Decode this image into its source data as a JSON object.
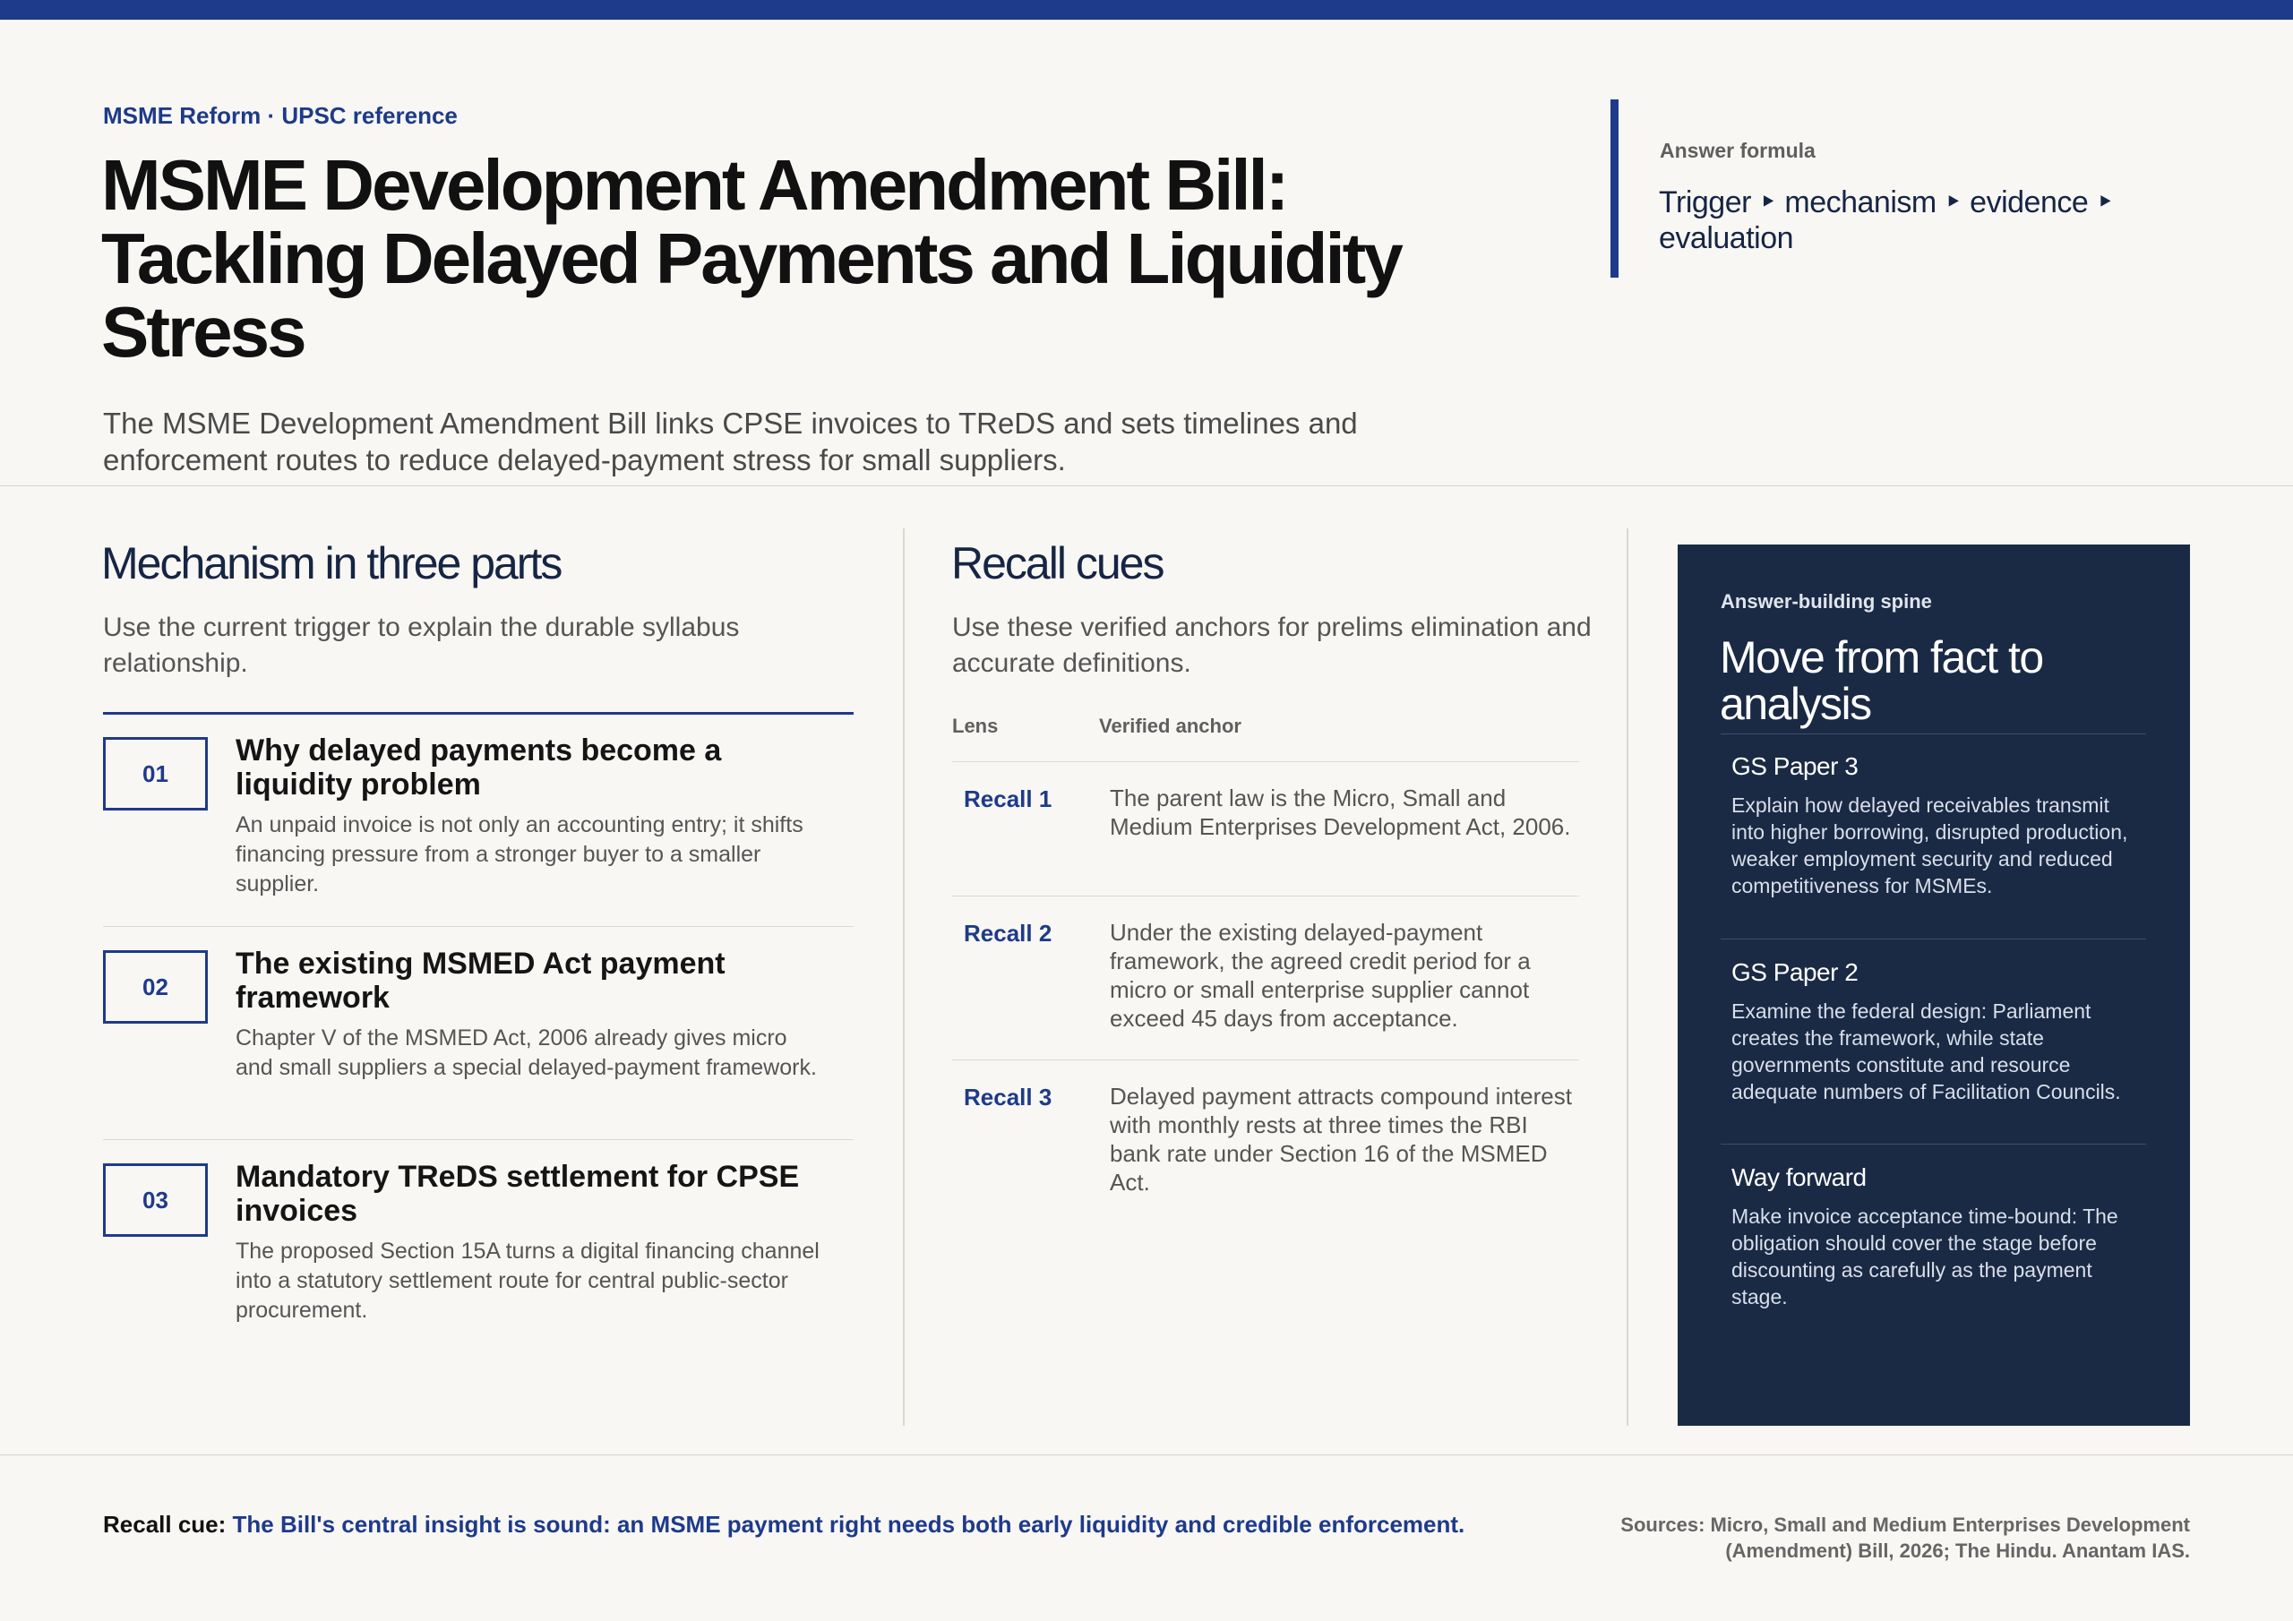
{
  "header": {
    "eyebrow": "MSME Reform · UPSC reference",
    "title": "MSME Development Amendment Bill: Tackling Delayed Payments and Liquidity Stress",
    "lede": "The MSME Development Amendment Bill links CPSE invoices to TReDS and sets timelines and enforcement routes to reduce delayed-payment stress for small suppliers."
  },
  "formula": {
    "label": "Answer formula",
    "text": "Trigger ‣ mechanism ‣ evidence ‣ evaluation"
  },
  "mechanism": {
    "heading": "Mechanism in three parts",
    "sub": "Use the current trigger to explain the durable syllabus relationship.",
    "items": [
      {
        "num": "01",
        "title": "Why delayed payments become a liquidity problem",
        "desc": "An unpaid invoice is not only an accounting entry; it shifts financing pressure from a stronger buyer to a smaller supplier."
      },
      {
        "num": "02",
        "title": "The existing MSMED Act payment framework",
        "desc": "Chapter V of the MSMED Act, 2006 already gives micro and small suppliers a special delayed-payment framework."
      },
      {
        "num": "03",
        "title": "Mandatory TReDS settlement for CPSE invoices",
        "desc": "The proposed Section 15A turns a digital financing channel into a statutory settlement route for central public-sector procurement."
      }
    ]
  },
  "recall": {
    "heading": "Recall cues",
    "sub": "Use these verified anchors for prelims elimination and accurate definitions.",
    "col_lens": "Lens",
    "col_anchor": "Verified anchor",
    "rows": [
      {
        "lens": "Recall 1",
        "anchor": "The parent law is the Micro, Small and Medium Enterprises Development Act, 2006."
      },
      {
        "lens": "Recall 2",
        "anchor": "Under the existing delayed-payment framework, the agreed credit period for a micro or small enterprise supplier cannot exceed 45 days from acceptance."
      },
      {
        "lens": "Recall 3",
        "anchor": "Delayed payment attracts compound interest with monthly rests at three times the RBI bank rate under Section 16 of the MSMED Act."
      }
    ]
  },
  "spine": {
    "eyebrow": "Answer-building spine",
    "title": "Move from fact to analysis",
    "sections": [
      {
        "heading": "GS Paper 3",
        "text": "Explain how delayed receivables transmit into higher borrowing, disrupted production, weaker employment security and reduced competitiveness for MSMEs."
      },
      {
        "heading": "GS Paper 2",
        "text": "Examine the federal design: Parliament creates the framework, while state governments constitute and resource adequate numbers of Facilitation Councils."
      },
      {
        "heading": "Way forward",
        "text": "Make invoice acceptance time-bound: The obligation should cover the stage before discounting as carefully as the payment stage."
      }
    ]
  },
  "footer": {
    "cue_lead": "Recall cue: ",
    "cue_text": "The Bill's central insight is sound: an MSME payment right needs both early liquidity and credible enforcement.",
    "sources": "Sources: Micro, Small and Medium Enterprises Development (Amendment) Bill, 2026; The Hindu. Anantam IAS."
  },
  "colors": {
    "accent": "#1e3a8a",
    "panel": "#1a2a44",
    "background": "#f8f7f4"
  }
}
